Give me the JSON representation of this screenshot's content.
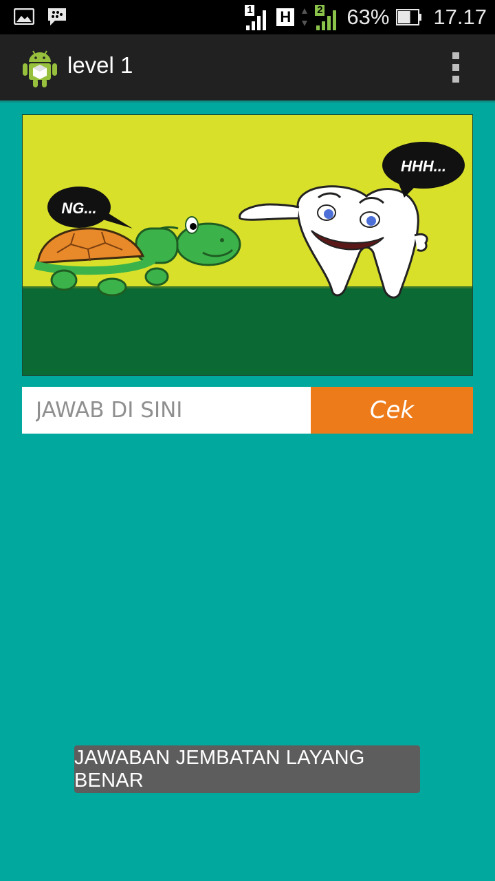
{
  "status_bar": {
    "icons": [
      "gallery-icon",
      "bbm-icon",
      "sim1-signal-icon",
      "hspa-icon",
      "sim2-signal-icon",
      "battery-icon"
    ],
    "sim1_label": "1",
    "network_type": "H",
    "sim2_label": "2",
    "battery_percent": "63%",
    "battery_level": 0.63,
    "time": "17.17"
  },
  "action_bar": {
    "title": "level 1",
    "app_icon": "android-app-icon",
    "menu_icon": "overflow-menu-icon"
  },
  "puzzle": {
    "turtle_speech": "NG...",
    "tooth_speech": "HHH...",
    "colors": {
      "sky": "#d9e02a",
      "ground": "#0b6934"
    }
  },
  "answer": {
    "placeholder": "JAWAB DI SINI",
    "value": "",
    "check_label": "Cek"
  },
  "toast": {
    "message": "JAWABAN JEMBATAN LAYANG BENAR"
  },
  "colors": {
    "background": "#00a89e",
    "action_bar": "#212121",
    "check_button": "#ee7b1a",
    "toast": "#5d5d5d"
  }
}
